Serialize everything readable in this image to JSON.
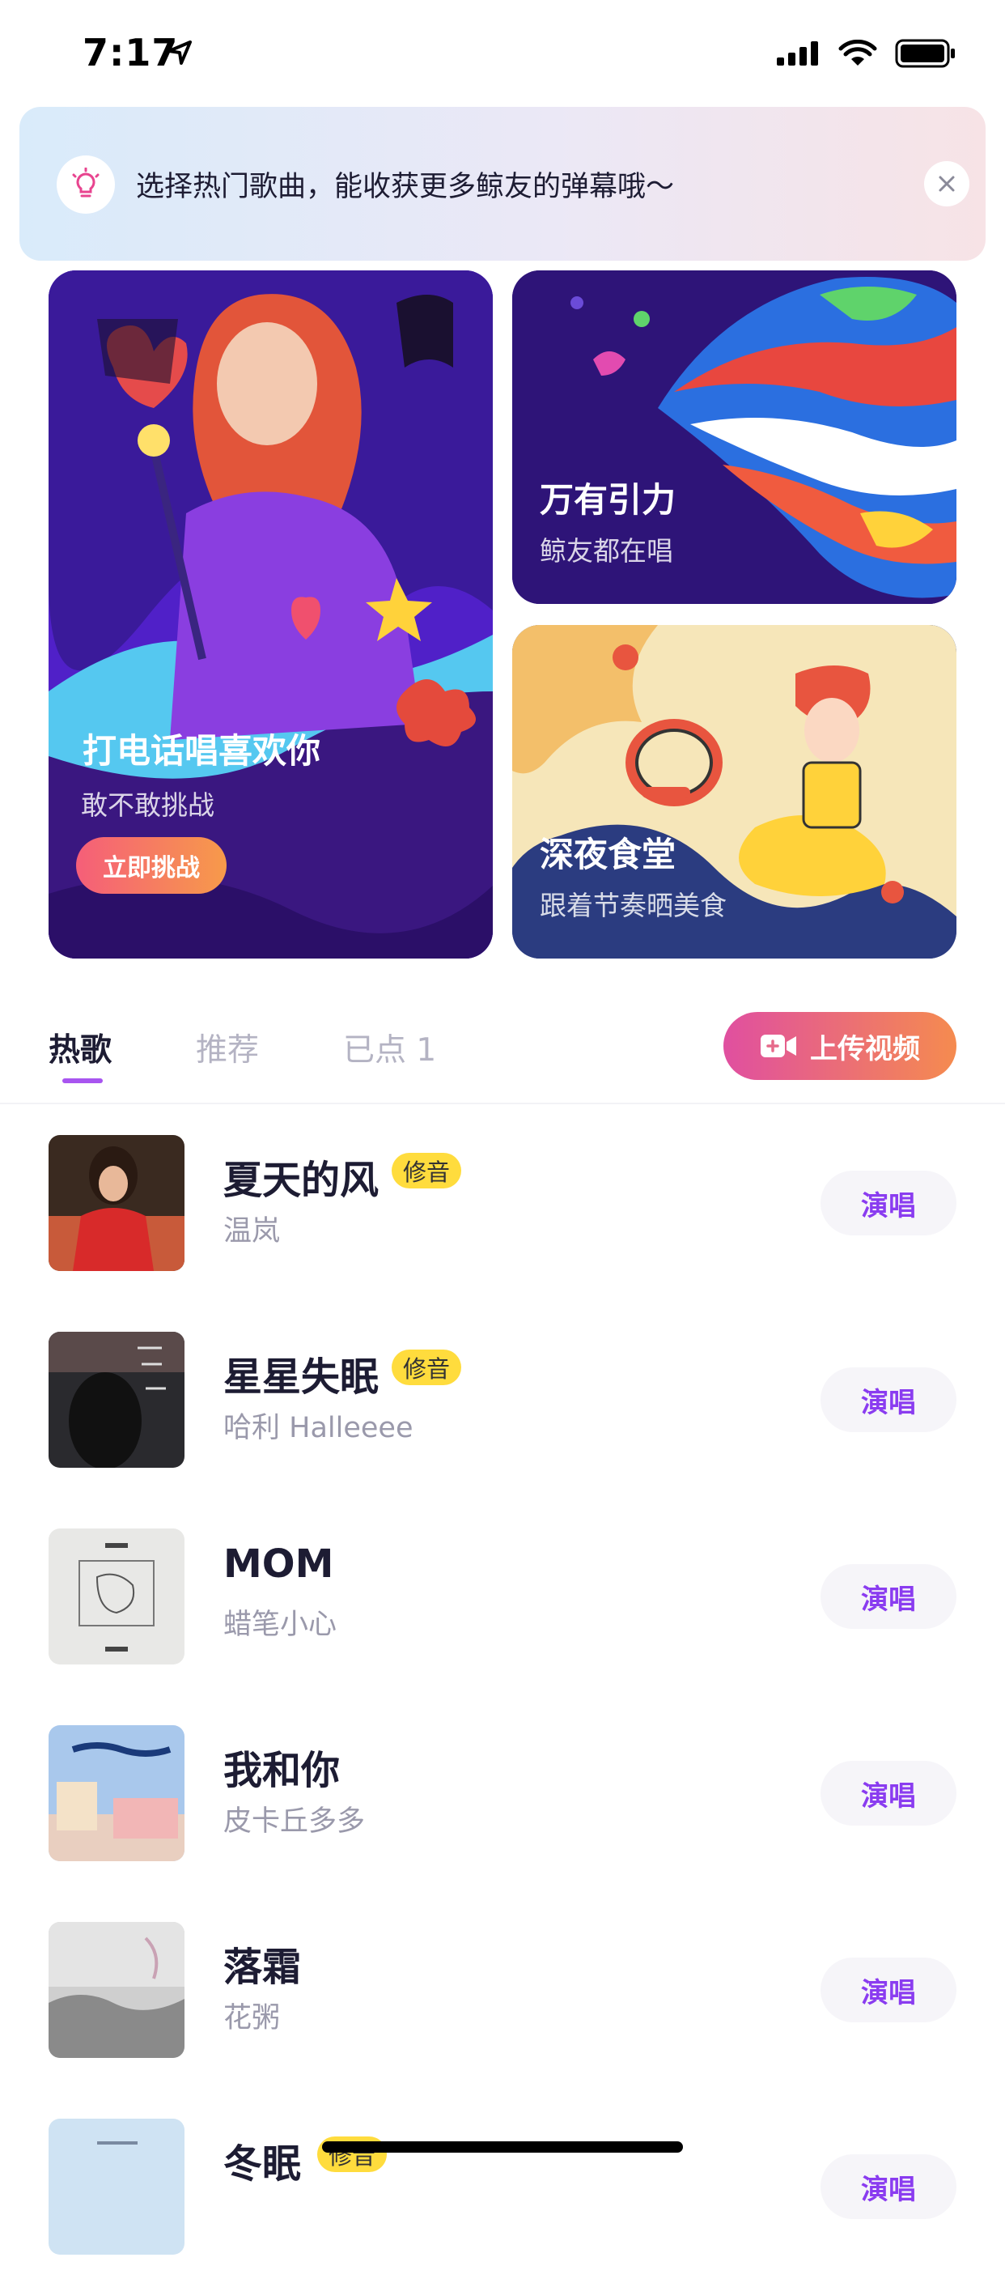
{
  "status_bar": {
    "time": "7:17"
  },
  "tip": {
    "text": "选择热门歌曲，能收获更多鲸友的弹幕哦～",
    "icon": "lightbulb-icon"
  },
  "cards": {
    "big": {
      "title": "打电话唱喜欢你",
      "subtitle": "敢不敢挑战",
      "button": "立即挑战"
    },
    "top_right": {
      "title": "万有引力",
      "subtitle": "鲸友都在唱"
    },
    "bottom_right": {
      "title": "深夜食堂",
      "subtitle": "跟着节奏晒美食"
    }
  },
  "tabs": [
    {
      "label": "热歌",
      "active": true
    },
    {
      "label": "推荐",
      "active": false
    },
    {
      "label": "已点 1",
      "active": false
    }
  ],
  "upload_button": "上传视频",
  "songs": [
    {
      "title": "夏天的风",
      "artist": "温岚",
      "badge": "修音",
      "action": "演唱"
    },
    {
      "title": "星星失眠",
      "artist": "哈利 Halleeee",
      "badge": "修音",
      "action": "演唱"
    },
    {
      "title": "MOM",
      "artist": "蜡笔小心",
      "badge": "",
      "action": "演唱"
    },
    {
      "title": "我和你",
      "artist": "皮卡丘多多",
      "badge": "",
      "action": "演唱"
    },
    {
      "title": "落霜",
      "artist": "花粥",
      "badge": "",
      "action": "演唱"
    },
    {
      "title": "冬眠",
      "artist": "",
      "badge": "修音",
      "action": "演唱"
    }
  ],
  "colors": {
    "accent": "#8a3cf0",
    "badge": "#ffdc3d",
    "upload_gradient_start": "#e04fa0",
    "upload_gradient_end": "#f58b4f"
  }
}
